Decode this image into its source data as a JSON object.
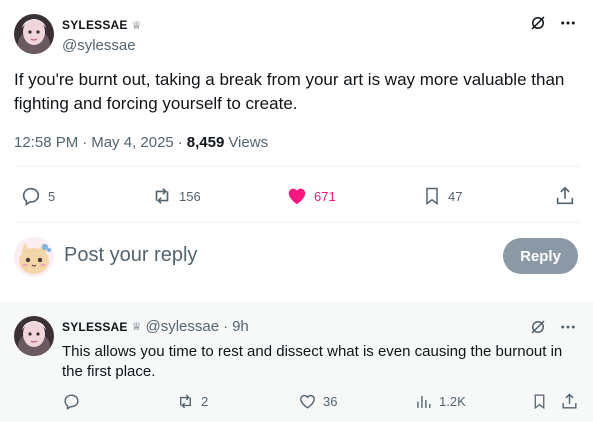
{
  "tweet": {
    "author_name": "SYLESSAE",
    "author_badge_icon": "crown-icon",
    "author_handle": "@sylessae",
    "text": "If you're burnt out, taking a break from your art is way more valuable than fighting and forcing yourself to create.",
    "time": "12:58 PM",
    "separator": "·",
    "date": "May 4, 2025",
    "views_count": "8,459",
    "views_label": "Views",
    "replies": "5",
    "reposts": "156",
    "likes": "671",
    "bookmarks": "47",
    "like_color": "#f91880"
  },
  "composer": {
    "placeholder": "Post your reply",
    "reply_button": "Reply",
    "reply_button_color": "#8b98a5"
  },
  "reply": {
    "author_name": "SYLESSAE",
    "author_handle": "@sylessae",
    "separator": "·",
    "age": "9h",
    "text": "This allows you time to rest and dissect what is even causing the burnout in the first place.",
    "reposts": "2",
    "likes": "36",
    "views": "1.2K"
  }
}
